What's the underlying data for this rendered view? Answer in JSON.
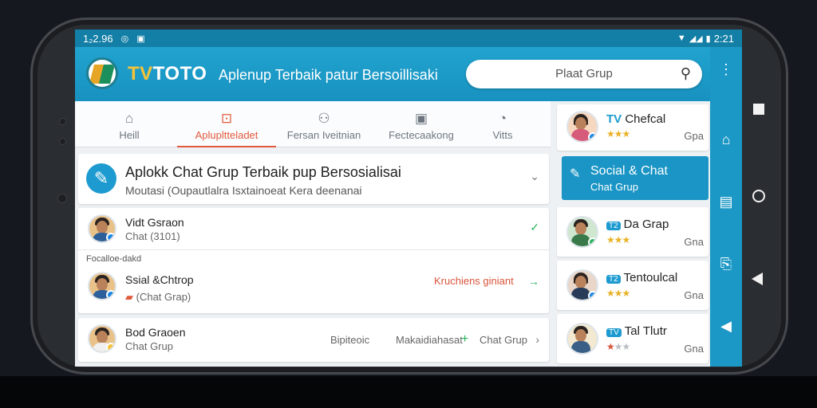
{
  "status_bar": {
    "time": "1₂2.96",
    "clock": "2:21"
  },
  "app": {
    "brand_prefix": "TV",
    "brand_rest": "TOTO",
    "tagline": "Aplenup Terbaik patur Bersoillisaki",
    "search_placeholder": "Plaat Grup"
  },
  "tabs": [
    {
      "label": "Heill",
      "icon": "home-icon"
    },
    {
      "label": "Aplupltteladet",
      "icon": "bookmark-icon",
      "active": true
    },
    {
      "label": "Fersan Iveitnian",
      "icon": "chat-icon"
    },
    {
      "label": "Fectecaakong",
      "icon": "image-icon"
    },
    {
      "label": "Vitts",
      "icon": "settings-icon"
    }
  ],
  "hero": {
    "title": "Aplokk Chat Grup Terbaik pup Bersosialisai",
    "subtitle": "Moutasi (Oupautlalra Isxtainoeat Kera deenanai"
  },
  "list": [
    {
      "name": "Vidt Gsraon",
      "sub": "Chat (3101)"
    },
    {
      "name": "Ssial &Chtrop",
      "sub": "(Chat Grap)",
      "action": "Kruchiens giniant"
    },
    {
      "name": "Bod Graoen",
      "sub": "Chat Grup",
      "action_prefix": "Bipiteoic",
      "action_mid": "Makaidiahasat",
      "action": "Chat Grup"
    }
  ],
  "section_label": "Focalloe-dakd",
  "right_panel": {
    "top": {
      "prefix": "TV",
      "name": "Chefcal",
      "meta": "Gpa"
    },
    "social": {
      "title": "Social & Chat",
      "subtitle": "Chat Grup"
    },
    "items": [
      {
        "tag": "T2",
        "name": "Da Grap",
        "meta": "Gna"
      },
      {
        "tag": "T2",
        "name": "Tentoulcal",
        "meta": "Gna"
      },
      {
        "tag": "TV",
        "name": "Tal Tlutr",
        "meta": "Gna"
      }
    ]
  },
  "colors": {
    "app_bar": "#1892c0",
    "active_tab": "#e2593d",
    "accent_green": "#2bb35c",
    "star": "#e9b227"
  }
}
